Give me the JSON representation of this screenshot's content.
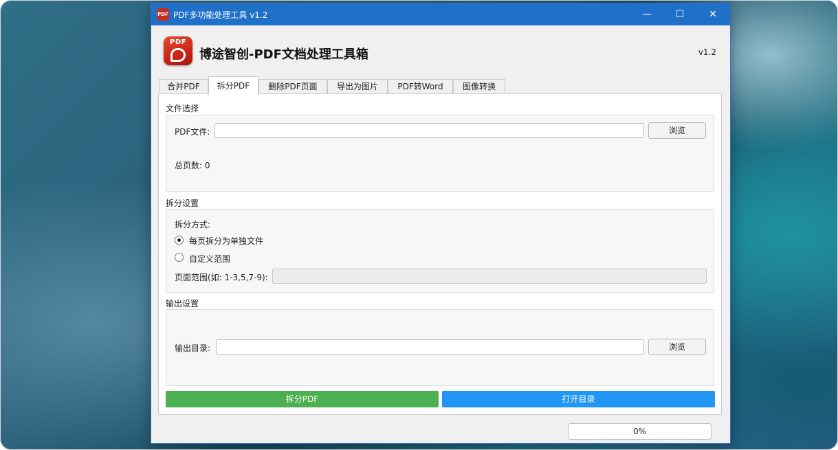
{
  "window": {
    "title": "PDF多功能处理工具 v1.2",
    "icon_text": "PDF",
    "controls": {
      "minimize": "—",
      "maximize": "☐",
      "close": "✕"
    }
  },
  "header": {
    "logo_text": "PDF",
    "title": "博途智创-PDF文档处理工具箱",
    "version": "v1.2"
  },
  "tabs": [
    {
      "label": "合并PDF",
      "active": false
    },
    {
      "label": "拆分PDF",
      "active": true
    },
    {
      "label": "删除PDF页面",
      "active": false
    },
    {
      "label": "导出为图片",
      "active": false
    },
    {
      "label": "PDF转Word",
      "active": false
    },
    {
      "label": "图像转换",
      "active": false
    }
  ],
  "file_section": {
    "title": "文件选择",
    "pdf_label": "PDF文件:",
    "pdf_value": "",
    "browse_label": "浏览",
    "total_pages_label": "总页数:",
    "total_pages_value": "0"
  },
  "split_section": {
    "title": "拆分设置",
    "mode_label": "拆分方式:",
    "options": [
      {
        "label": "每页拆分为单独文件",
        "checked": true
      },
      {
        "label": "自定义范围",
        "checked": false
      }
    ],
    "range_label": "页面范围(如: 1-3,5,7-9):",
    "range_value": ""
  },
  "output_section": {
    "title": "输出设置",
    "dir_label": "输出目录:",
    "dir_value": "",
    "browse_label": "浏览"
  },
  "actions": {
    "split_label": "拆分PDF",
    "split_color": "#4caf50",
    "open_dir_label": "打开目录",
    "open_dir_color": "#2196f3"
  },
  "progress": {
    "value": 0,
    "text": "0%"
  }
}
